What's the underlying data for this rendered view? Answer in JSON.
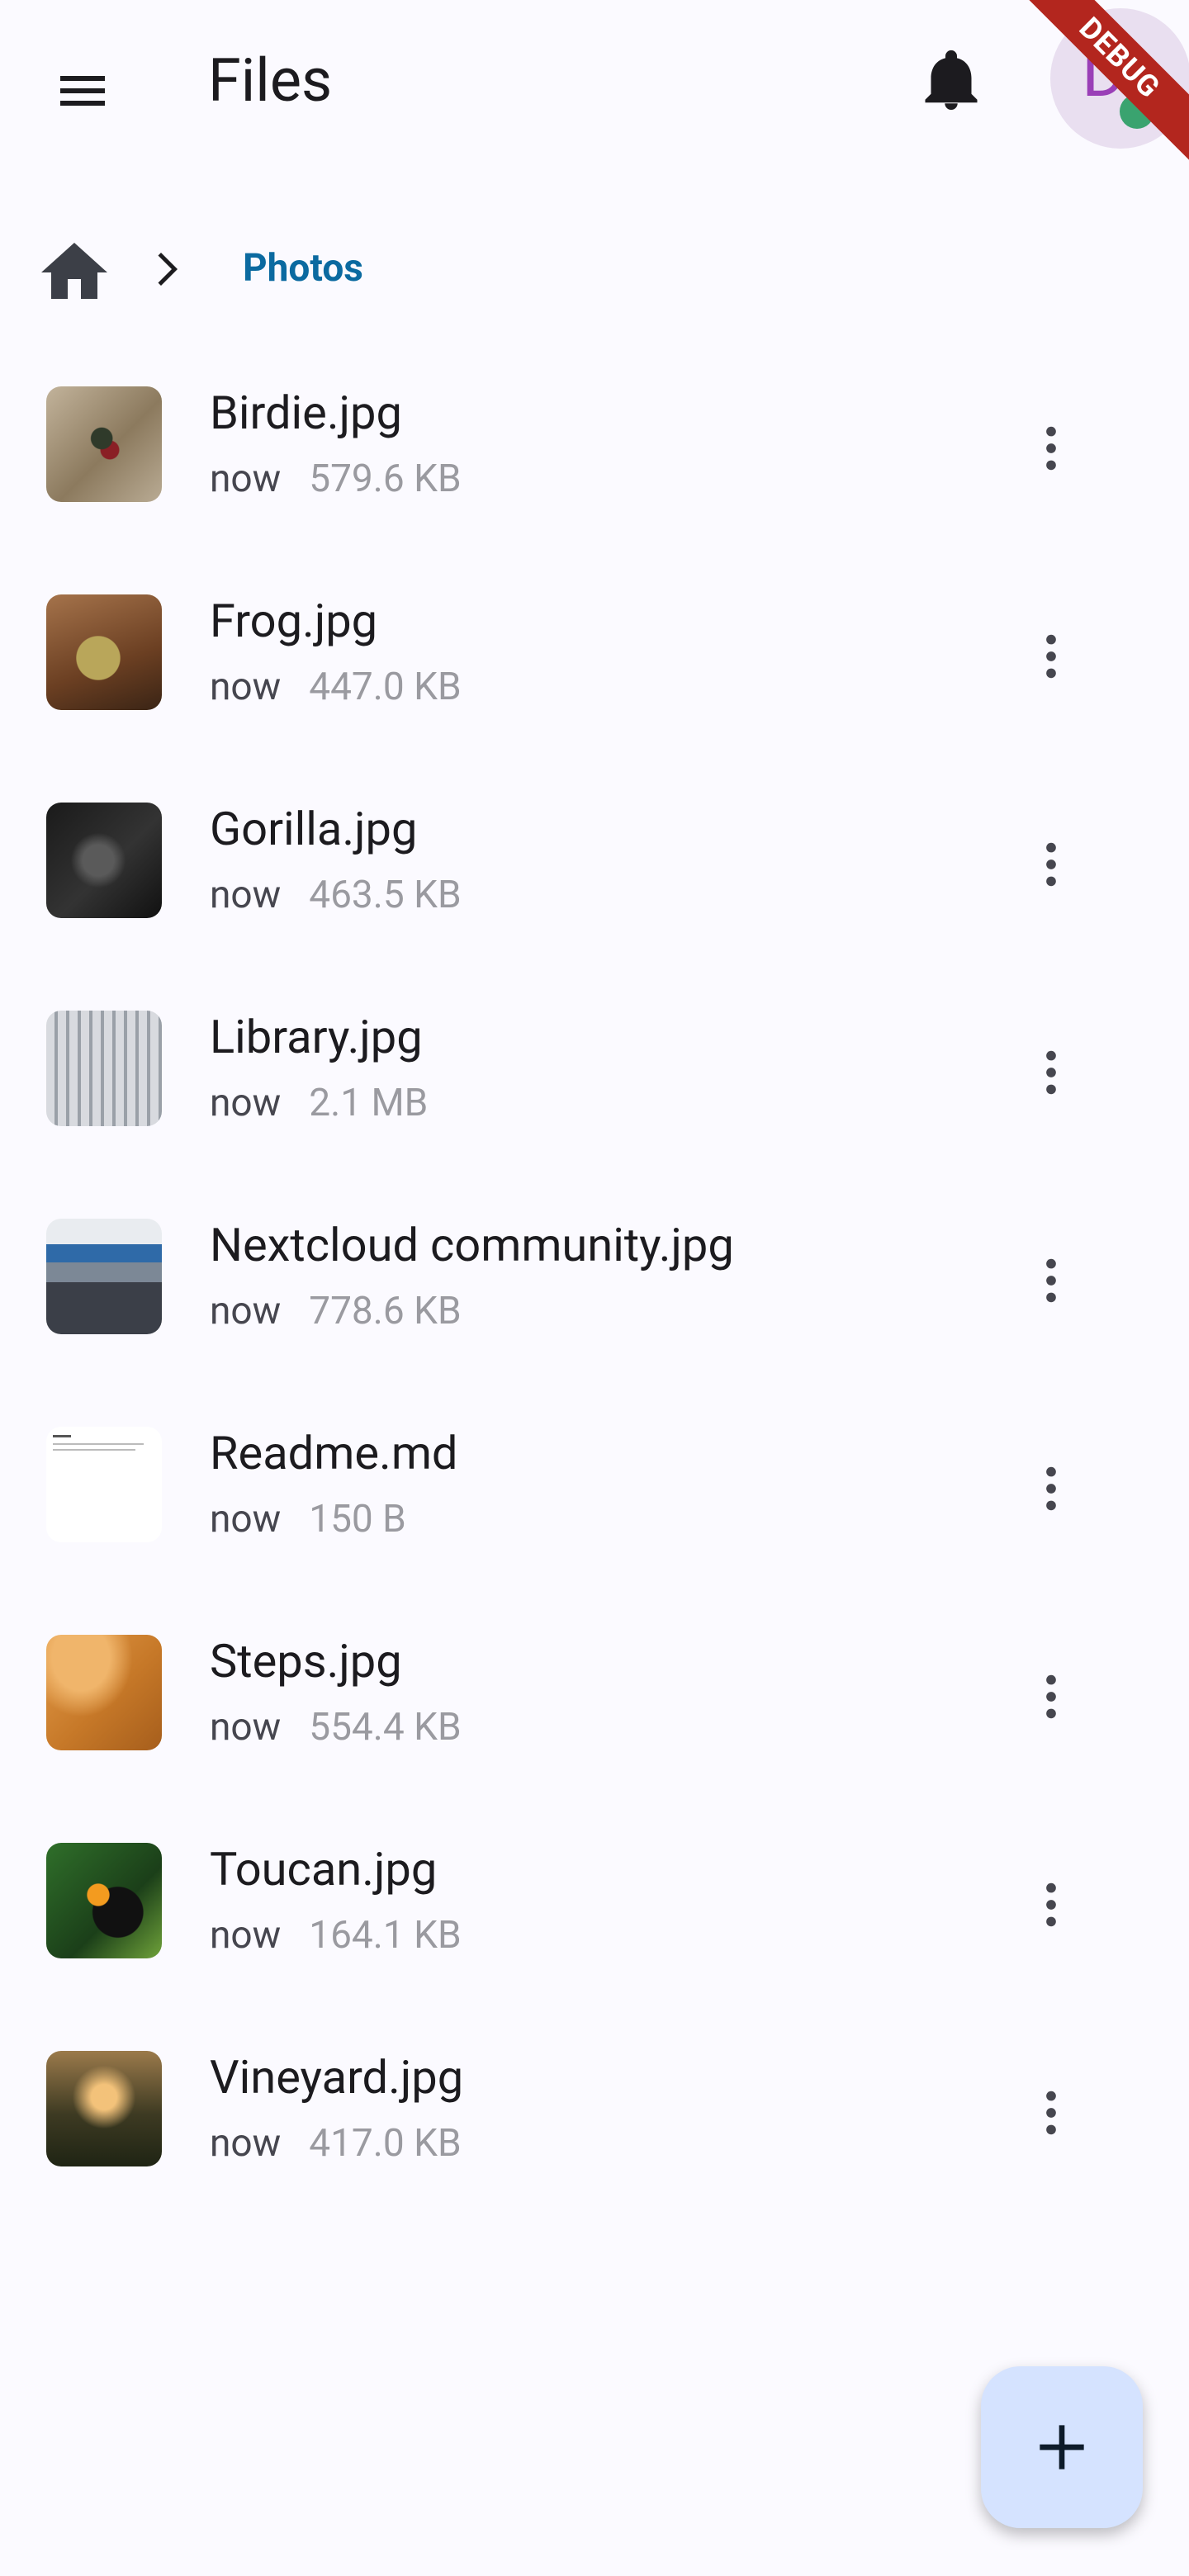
{
  "app": {
    "title": "Files",
    "avatar_letter": "D",
    "debug_banner": "DEBUG",
    "colors": {
      "background": "#fbfaff",
      "accent": "#0b6aa0",
      "fab": "#d5e3ff",
      "avatar_bg": "#e9dff0",
      "status": "#3aa36f",
      "debug_ribbon": "#b3261e"
    }
  },
  "icons": {
    "menu": "menu-icon",
    "notifications": "bell-icon",
    "home": "home-icon",
    "separator": "chevron-right-icon",
    "more": "more-vert-icon",
    "fab": "plus-icon"
  },
  "breadcrumb": {
    "current": "Photos"
  },
  "files": [
    {
      "name": "Birdie.jpg",
      "time": "now",
      "size": "579.6 KB"
    },
    {
      "name": "Frog.jpg",
      "time": "now",
      "size": "447.0 KB"
    },
    {
      "name": "Gorilla.jpg",
      "time": "now",
      "size": "463.5 KB"
    },
    {
      "name": "Library.jpg",
      "time": "now",
      "size": "2.1 MB"
    },
    {
      "name": "Nextcloud community.jpg",
      "time": "now",
      "size": "778.6 KB"
    },
    {
      "name": "Readme.md",
      "time": "now",
      "size": "150 B"
    },
    {
      "name": "Steps.jpg",
      "time": "now",
      "size": "554.4 KB"
    },
    {
      "name": "Toucan.jpg",
      "time": "now",
      "size": "164.1 KB"
    },
    {
      "name": "Vineyard.jpg",
      "time": "now",
      "size": "417.0 KB"
    }
  ]
}
